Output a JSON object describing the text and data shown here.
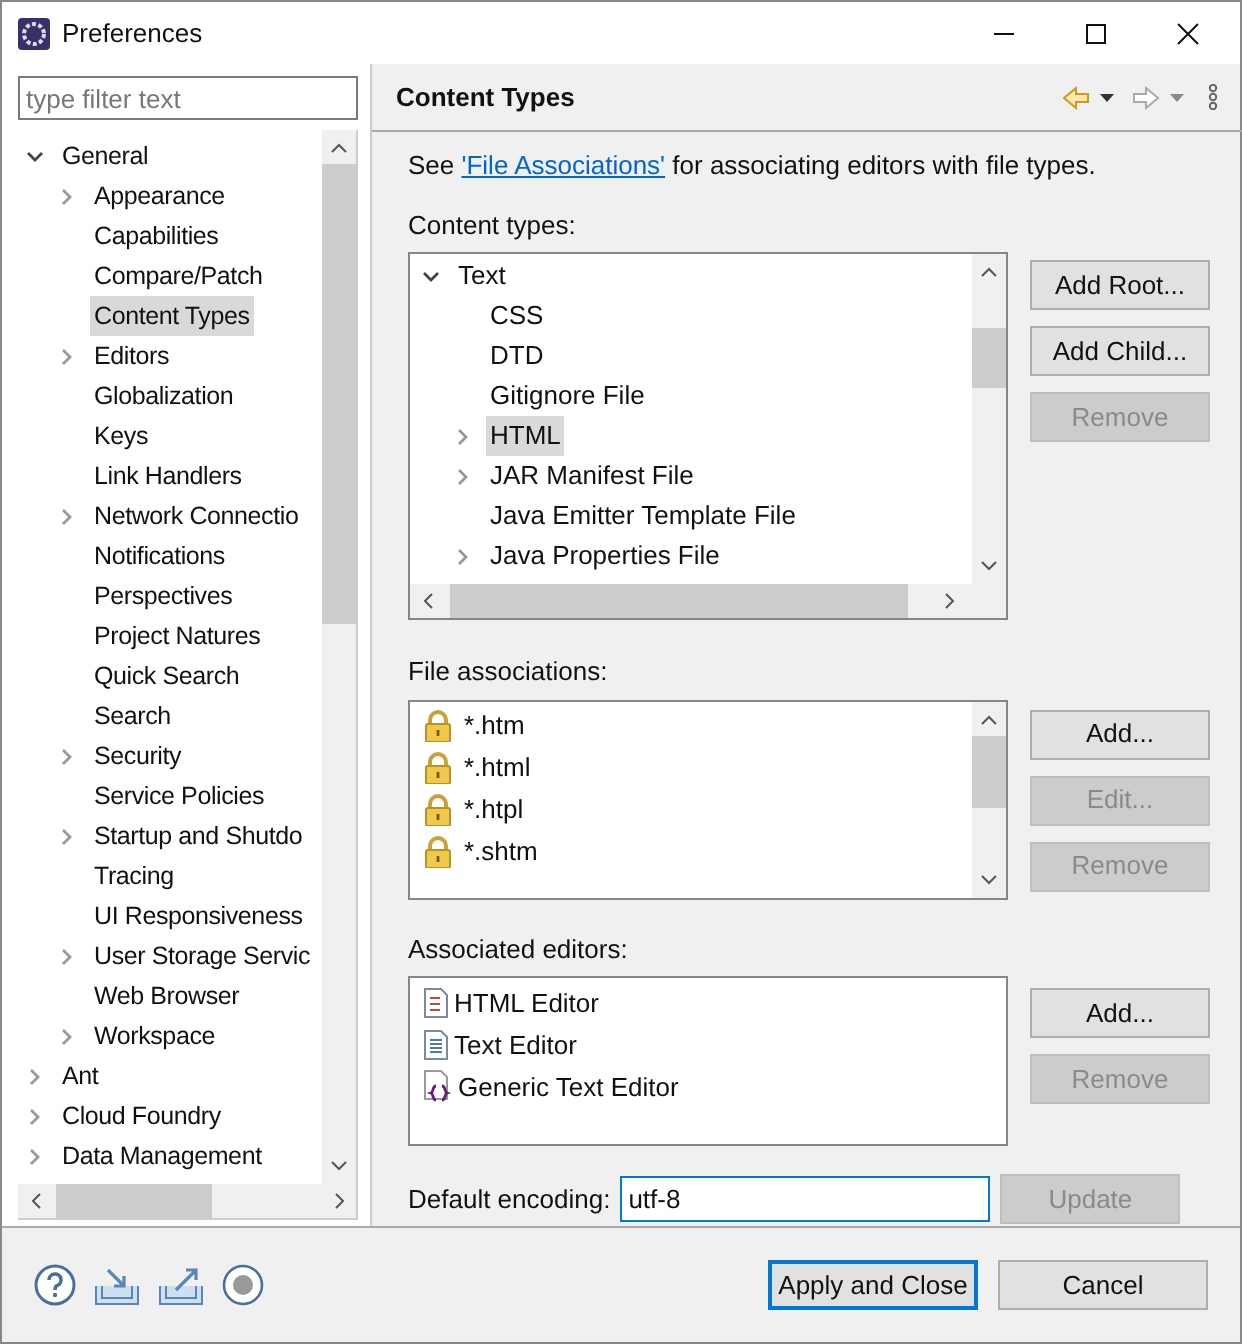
{
  "window": {
    "title": "Preferences"
  },
  "filter": {
    "placeholder": "type filter text"
  },
  "nav_tree": [
    {
      "label": "General",
      "expanded": true,
      "selected": false,
      "children": [
        {
          "label": "Appearance",
          "expanded": false,
          "selected": false
        },
        {
          "label": "Capabilities",
          "selected": false
        },
        {
          "label": "Compare/Patch",
          "selected": false
        },
        {
          "label": "Content Types",
          "selected": true
        },
        {
          "label": "Editors",
          "expanded": false,
          "selected": false
        },
        {
          "label": "Globalization",
          "selected": false
        },
        {
          "label": "Keys",
          "selected": false
        },
        {
          "label": "Link Handlers",
          "selected": false
        },
        {
          "label": "Network Connectio",
          "expanded": false,
          "selected": false
        },
        {
          "label": "Notifications",
          "selected": false
        },
        {
          "label": "Perspectives",
          "selected": false
        },
        {
          "label": "Project Natures",
          "selected": false
        },
        {
          "label": "Quick Search",
          "selected": false
        },
        {
          "label": "Search",
          "selected": false
        },
        {
          "label": "Security",
          "expanded": false,
          "selected": false
        },
        {
          "label": "Service Policies",
          "selected": false
        },
        {
          "label": "Startup and Shutdo",
          "expanded": false,
          "selected": false
        },
        {
          "label": "Tracing",
          "selected": false
        },
        {
          "label": "UI Responsiveness",
          "selected": false
        },
        {
          "label": "User Storage Servic",
          "expanded": false,
          "selected": false
        },
        {
          "label": "Web Browser",
          "selected": false
        },
        {
          "label": "Workspace",
          "expanded": false,
          "selected": false
        }
      ]
    },
    {
      "label": "Ant",
      "expanded": false,
      "selected": false
    },
    {
      "label": "Cloud Foundry",
      "expanded": false,
      "selected": false
    },
    {
      "label": "Data Management",
      "expanded": false,
      "selected": false
    }
  ],
  "page": {
    "title": "Content Types",
    "intro": {
      "before": "See ",
      "link": "'File Associations'",
      "after": " for associating editors with file types."
    },
    "content_types": {
      "label": "Content types:",
      "tree": [
        {
          "label": "Text",
          "expanded": true,
          "selected": false,
          "children": [
            {
              "label": "CSS",
              "selected": false
            },
            {
              "label": "DTD",
              "selected": false
            },
            {
              "label": "Gitignore File",
              "selected": false
            },
            {
              "label": "HTML",
              "expanded": false,
              "selected": true
            },
            {
              "label": "JAR Manifest File",
              "expanded": false,
              "selected": false
            },
            {
              "label": "Java Emitter Template File",
              "selected": false
            },
            {
              "label": "Java Properties File",
              "expanded": false,
              "selected": false
            }
          ]
        }
      ],
      "buttons": [
        {
          "label": "Add Root...",
          "disabled": false
        },
        {
          "label": "Add Child...",
          "disabled": false
        },
        {
          "label": "Remove",
          "disabled": true
        }
      ]
    },
    "file_associations": {
      "label": "File associations:",
      "items": [
        "*.htm",
        "*.html",
        "*.htpl",
        "*.shtm"
      ],
      "buttons": [
        {
          "label": "Add...",
          "disabled": false
        },
        {
          "label": "Edit...",
          "disabled": true
        },
        {
          "label": "Remove",
          "disabled": true
        }
      ]
    },
    "associated_editors": {
      "label": "Associated editors:",
      "items": [
        {
          "label": "HTML Editor",
          "kind": "html"
        },
        {
          "label": "Text Editor",
          "kind": "text"
        },
        {
          "label": "Generic Text Editor",
          "kind": "generic"
        }
      ],
      "buttons": [
        {
          "label": "Add...",
          "disabled": false
        },
        {
          "label": "Remove",
          "disabled": true
        }
      ]
    },
    "encoding": {
      "label": "Default encoding:",
      "value": "utf-8",
      "button": {
        "label": "Update",
        "disabled": true
      }
    }
  },
  "footer_buttons": [
    {
      "label": "Apply and Close",
      "default": true
    },
    {
      "label": "Cancel",
      "default": false
    }
  ]
}
